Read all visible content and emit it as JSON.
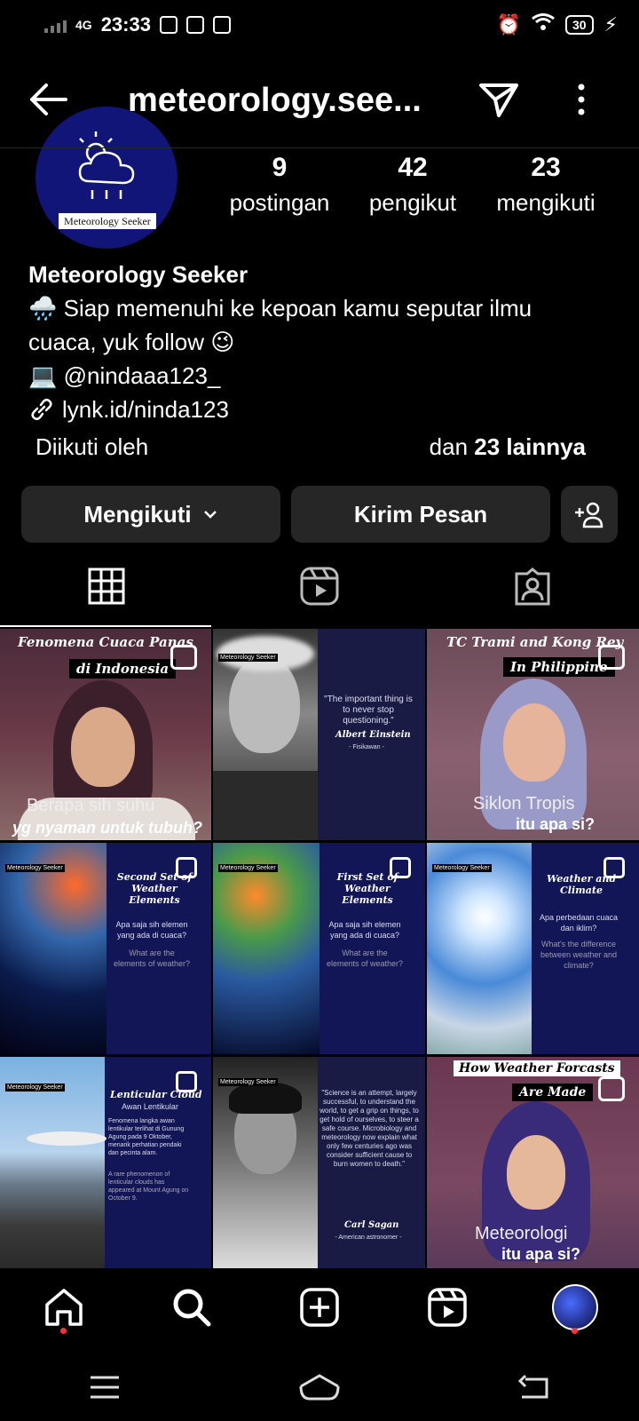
{
  "status_bar": {
    "network": "4G",
    "time": "23:33",
    "battery": "30"
  },
  "header": {
    "title": "meteorology.see...",
    "back_icon": "arrow-left-icon",
    "send_icon": "paper-plane-icon",
    "more_icon": "more-vertical-icon"
  },
  "profile": {
    "avatar_text": "Meteorology Seeker",
    "stats": [
      {
        "number": "9",
        "label": "postingan"
      },
      {
        "number": "42",
        "label": "pengikut"
      },
      {
        "number": "23",
        "label": "mengikuti"
      }
    ],
    "name": "Meteorology Seeker",
    "bio_line1": "🌧️ Siap memenuhi ke kepoan kamu seputar ilmu",
    "bio_line2": "cuaca, yuk follow 😉",
    "bio_line3": "💻 @nindaaa123_",
    "link": "lynk.id/ninda123",
    "followed_by": "Diikuti oleh",
    "followed_others_prefix": "dan ",
    "followed_others_count": "23 lainnya"
  },
  "actions": {
    "following_label": "Mengikuti",
    "message_label": "Kirim Pesan"
  },
  "posts": [
    {
      "caption1": "Fenomena Cuaca Panas",
      "caption2": "di Indonesia",
      "sub1": "Berapa sih suhu",
      "sub2": "yg nyaman untuk tubuh?"
    },
    {
      "brand": "Meteorology Seeker",
      "quote": "\"The important thing is to never stop questioning.\"",
      "author": "Albert Einstein",
      "role": "- Fisikawan -"
    },
    {
      "caption1": "TC Trami and Kong Rey",
      "caption2": "In Philippine",
      "sub1": "Siklon Tropis",
      "sub2": "itu apa si?"
    },
    {
      "brand": "Meteorology Seeker",
      "title": "Second Set of Weather Elements",
      "q1": "Apa saja sih elemen yang ada di cuaca?",
      "q2": "What are the elements of weather?"
    },
    {
      "brand": "Meteorology Seeker",
      "title": "First Set of Weather Elements",
      "q1": "Apa saja sih elemen yang ada di cuaca?",
      "q2": "What are the elements of weather?"
    },
    {
      "brand": "Meteorology Seeker",
      "title": "Weather and Climate",
      "q1": "Apa perbedaan cuaca dan iklim?",
      "q2": "What's the difference between weather and climate?"
    },
    {
      "brand": "Meteorology Seeker",
      "title": "Lenticular Cloud",
      "subtitle": "Awan Lentikular",
      "q1": "Fenomena langka awan lentikular terlihat di Gunung Agung pada 9 Oktober, menarik perhatian pendaki dan pecinta alam.",
      "q2": "A rare phenomenon of lenticular clouds has appeared at Mount Agung on October 9."
    },
    {
      "brand": "Meteorology Seeker",
      "quote": "\"Science is an attempt, largely successful, to understand the world, to get a grip on things, to get hold of ourselves, to steer a safe course. Microbiology and meteorology now explain what only few centuries ago was consider sufficient cause to burn women to death.\"",
      "author": "Carl Sagan",
      "role": "- American astronomer -"
    },
    {
      "caption1": "How Weather Forcasts",
      "caption2": "Are Made",
      "sub1": "Meteorologi",
      "sub2": "itu apa si?"
    }
  ],
  "colors": {
    "background": "#000000",
    "button_bg": "#262626",
    "avatar_bg": "#111577",
    "notification_dot": "#ff3040"
  }
}
